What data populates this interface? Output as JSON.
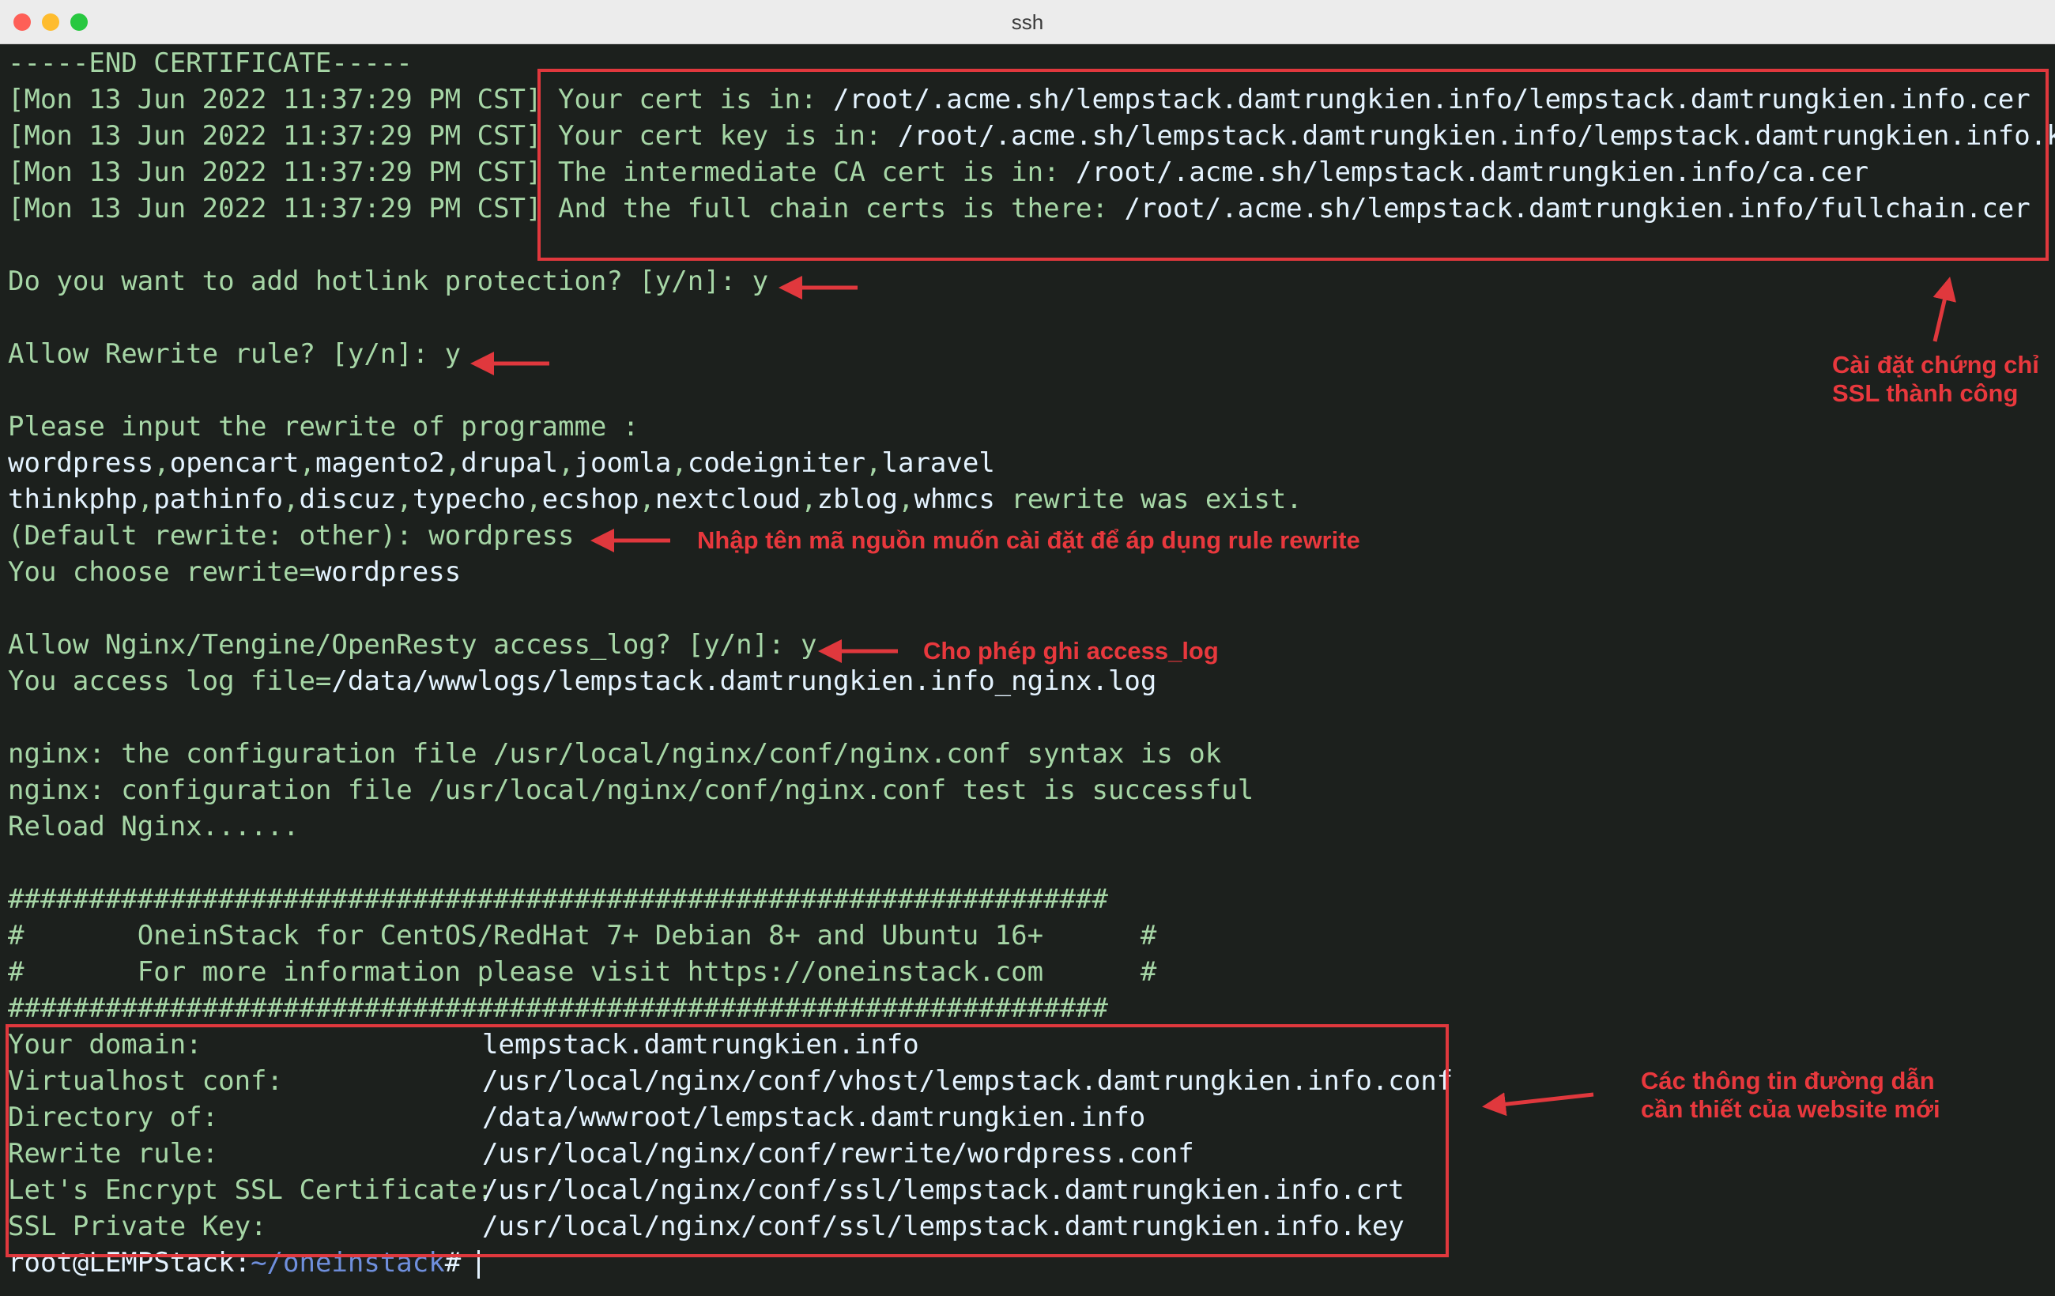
{
  "window": {
    "title": "ssh"
  },
  "terminal": {
    "end_cert": "-----END CERTIFICATE-----",
    "cert_lines": [
      {
        "ts": "[Mon 13 Jun 2022 11:37:29 PM CST]",
        "label": " Your cert is in: ",
        "path": "/root/.acme.sh/lempstack.damtrungkien.info/lempstack.damtrungkien.info.cer"
      },
      {
        "ts": "[Mon 13 Jun 2022 11:37:29 PM CST]",
        "label": " Your cert key is in: ",
        "path": "/root/.acme.sh/lempstack.damtrungkien.info/lempstack.damtrungkien.info.key"
      },
      {
        "ts": "[Mon 13 Jun 2022 11:37:29 PM CST]",
        "label": " The intermediate CA cert is in: ",
        "path": "/root/.acme.sh/lempstack.damtrungkien.info/ca.cer"
      },
      {
        "ts": "[Mon 13 Jun 2022 11:37:29 PM CST]",
        "label": " And the full chain certs is there: ",
        "path": "/root/.acme.sh/lempstack.damtrungkien.info/fullchain.cer"
      }
    ],
    "hotlink_q": "Do you want to add hotlink protection? [y/n]: y",
    "rewrite_q": "Allow Rewrite rule? [y/n]: y",
    "rewrite_prompt": "Please input the rewrite of programme :",
    "programmes_1": [
      "wordpress",
      "opencart",
      "magento2",
      "drupal",
      "joomla",
      "codeigniter",
      "laravel"
    ],
    "programmes_2": [
      "thinkphp",
      "pathinfo",
      "discuz",
      "typecho",
      "ecshop",
      "nextcloud",
      "zblog",
      "whmcs"
    ],
    "rewrite_exist": " rewrite was exist.",
    "default_rewrite": "(Default rewrite: other): wordpress",
    "choose_label": "You choose rewrite=",
    "choose_value": "wordpress",
    "access_q": "Allow Nginx/Tengine/OpenResty access_log? [y/n]: y",
    "access_label": "You access log file=",
    "access_value": "/data/wwwlogs/lempstack.damtrungkien.info_nginx.log",
    "nginx_1": "nginx: the configuration file /usr/local/nginx/conf/nginx.conf syntax is ok",
    "nginx_2": "nginx: configuration file /usr/local/nginx/conf/nginx.conf test is successful",
    "reload": "Reload Nginx......",
    "hash_line": "####################################################################",
    "banner_1": "#       OneinStack for CentOS/RedHat 7+ Debian 8+ and Ubuntu 16+      #",
    "banner_2": "#       For more information please visit https://oneinstack.com      #",
    "info": [
      {
        "label": "Your domain:",
        "value": "lempstack.damtrungkien.info"
      },
      {
        "label": "Virtualhost conf:",
        "value": "/usr/local/nginx/conf/vhost/lempstack.damtrungkien.info.conf"
      },
      {
        "label": "Directory of:",
        "value": "/data/wwwroot/lempstack.damtrungkien.info"
      },
      {
        "label": "Rewrite rule:",
        "value": "/usr/local/nginx/conf/rewrite/wordpress.conf"
      },
      {
        "label": "Let's Encrypt SSL Certificate:",
        "value": "/usr/local/nginx/conf/ssl/lempstack.damtrungkien.info.crt"
      },
      {
        "label": "SSL Private Key:",
        "value": "/usr/local/nginx/conf/ssl/lempstack.damtrungkien.info.key"
      }
    ],
    "prompt_user": "root@LEMPStack",
    "prompt_sep": ":",
    "prompt_path": "~/oneinstack",
    "prompt_end": "# "
  },
  "annotations": {
    "ssl_success": "Cài đặt chứng chỉ\nSSL thành công",
    "rewrite_note": "Nhập tên mã nguồn muốn cài đặt để áp dụng rule rewrite",
    "access_note": "Cho phép ghi access_log",
    "info_note": "Các thông tin đường dẫn\ncần thiết của website mới"
  },
  "colors": {
    "green_text": "#a6d6a6",
    "white_text": "#e4f3ff",
    "highlight_red": "#e0383d",
    "prompt_blue": "#6f8fdc"
  }
}
